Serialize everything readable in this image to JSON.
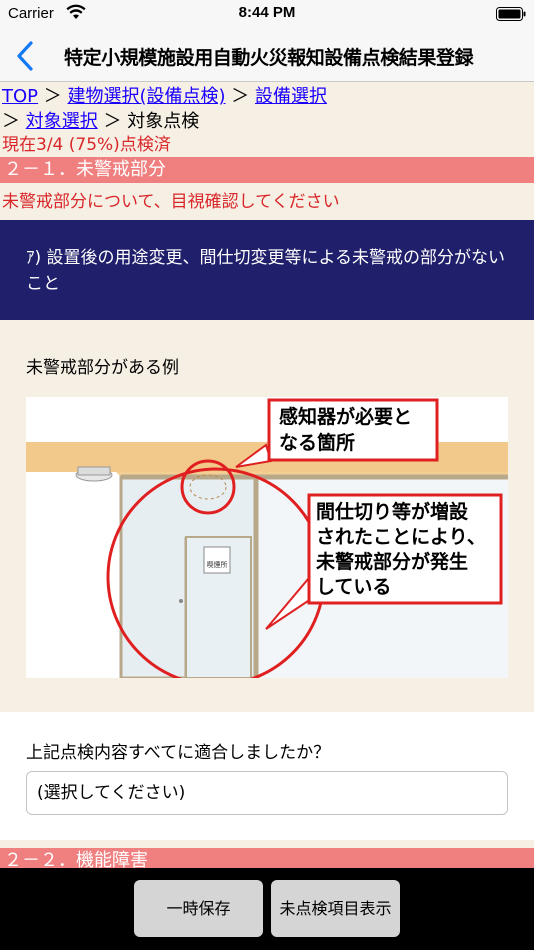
{
  "status": {
    "carrier": "Carrier",
    "time": "8:44 PM"
  },
  "nav": {
    "title": "特定小規模施設用自動火災報知設備点検結果登録"
  },
  "breadcrumb": {
    "top": "TOP",
    "sep": "＞",
    "building": "建物選択(設備点検)",
    "equipment": "設備選択",
    "target_select": "対象選択",
    "current": "対象点検"
  },
  "progress": "現在3/4 (75%)点検済",
  "section1": "２－１．未警戒部分",
  "instruction": "未警戒部分について、目視確認してください",
  "question": "ｱ) 設置後の用途変更、間仕切変更等による未警戒の部分がないこと",
  "example_label": "未警戒部分がある例",
  "diagram": {
    "callout_top": [
      "感知器が必要と",
      "なる箇所"
    ],
    "callout_mid": [
      "間仕切り等が増設",
      "されたことにより、",
      "未警戒部分が発生",
      "している"
    ],
    "sign_text": "喫煙所"
  },
  "answer": {
    "question": "上記点検内容すべてに適合しましたか？",
    "select_value": "(選択してください)"
  },
  "section2": "２－２．機能障害",
  "buttons": {
    "save": "一時保存",
    "unchecked": "未点検項目表示"
  }
}
